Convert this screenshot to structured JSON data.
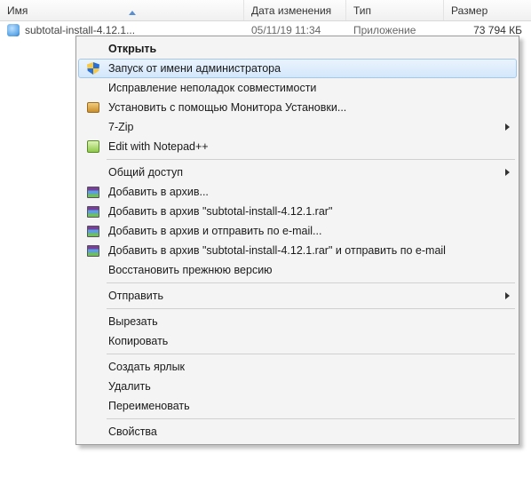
{
  "columns": {
    "name": "Имя",
    "date": "Дата изменения",
    "type": "Тип",
    "size": "Размер"
  },
  "file": {
    "name": "subtotal-install-4.12.1...",
    "date": "05/11/19 11:34",
    "type": "Приложение",
    "size": "73 794 КБ"
  },
  "menu": {
    "open": "Открыть",
    "runas": "Запуск от имени администратора",
    "compat": "Исправление неполадок совместимости",
    "monitor": "Установить с помощью Монитора Установки...",
    "sevenzip": "7-Zip",
    "npp": "Edit with Notepad++",
    "share": "Общий доступ",
    "addarch": "Добавить в архив...",
    "addrar": "Добавить в архив \"subtotal-install-4.12.1.rar\"",
    "addmail": "Добавить в архив и отправить по e-mail...",
    "addrarmail": "Добавить в архив \"subtotal-install-4.12.1.rar\" и отправить по e-mail",
    "restore": "Восстановить прежнюю версию",
    "sendto": "Отправить",
    "cut": "Вырезать",
    "copy": "Копировать",
    "shortcut": "Создать ярлык",
    "delete": "Удалить",
    "rename": "Переименовать",
    "props": "Свойства"
  }
}
